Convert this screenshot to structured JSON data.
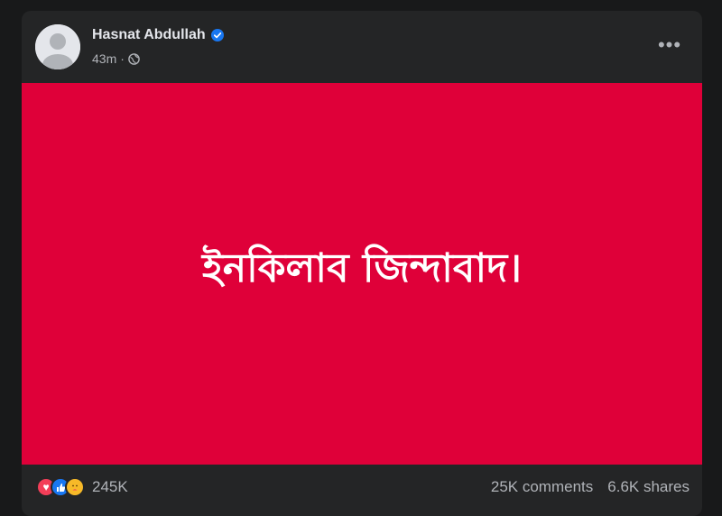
{
  "post": {
    "author": "Hasnat Abdullah",
    "time": "43m",
    "separator": "·",
    "more_label": "•••",
    "image_text": "ইনকিলাব জিন্দাবাদ।",
    "image_bg": "#df0039",
    "reactions": {
      "icons": [
        "love-icon",
        "like-icon",
        "care-icon"
      ],
      "count": "245K"
    },
    "comments": "25K comments",
    "shares": "6.6K shares"
  }
}
